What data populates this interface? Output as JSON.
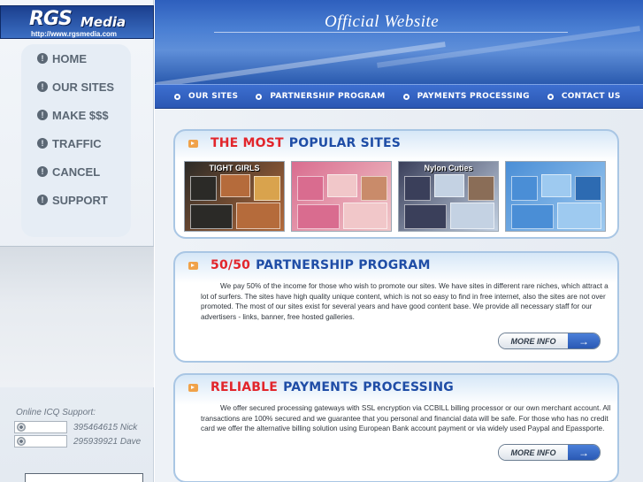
{
  "logo": {
    "brand": "RGS",
    "name": "Media",
    "url": "http://www.rgsmedia.com"
  },
  "header": {
    "title": "Official Website"
  },
  "sidebar": {
    "items": [
      {
        "label": "HOME",
        "icon": "info-bullet-icon"
      },
      {
        "label": "OUR SITES",
        "icon": "info-bullet-icon"
      },
      {
        "label": "MAKE $$$",
        "icon": "info-bullet-icon"
      },
      {
        "label": "TRAFFIC",
        "icon": "info-bullet-icon"
      },
      {
        "label": "CANCEL",
        "icon": "info-bullet-icon"
      },
      {
        "label": "SUPPORT",
        "icon": "info-bullet-icon"
      }
    ],
    "icq": {
      "title": "Online ICQ Support:",
      "contacts": [
        {
          "number": "395464615",
          "name": "Nick"
        },
        {
          "number": "295939921",
          "name": "Dave"
        }
      ]
    }
  },
  "topnav": {
    "items": [
      {
        "label": "OUR SITES"
      },
      {
        "label": "PARTNERSHIP PROGRAM"
      },
      {
        "label": "PAYMENTS PROCESSING"
      },
      {
        "label": "CONTACT US"
      }
    ]
  },
  "sections": {
    "popular": {
      "title_red": "THE MOST",
      "title_blue": "POPULAR SITES",
      "thumbnails": [
        {
          "caption": "TIGHT GIRLS",
          "colors": [
            "#2b2a27",
            "#b56b3b",
            "#d9a34d"
          ]
        },
        {
          "caption": "",
          "colors": [
            "#d96c8f",
            "#f1c7c9",
            "#c98b6a"
          ]
        },
        {
          "caption": "Nylon Cuties",
          "colors": [
            "#3a3f5a",
            "#c4d2e3",
            "#8a6d57"
          ]
        },
        {
          "caption": "",
          "colors": [
            "#4a8ed6",
            "#9ecaf0",
            "#2d6bb2"
          ]
        }
      ]
    },
    "partnership": {
      "title_red": "50/50",
      "title_blue": "PARTNERSHIP PROGRAM",
      "text": "We pay 50% of the income for those who wish to promote our sites. We have sites in different rare niches, which attract a lot of surfers. The sites have high quality unique content, which is not so easy to find in free internet, also the sites are not over promoted. The most of our sites exist for several years and have good content base. We provide all necessary staff for our advertisers - links, banner, free hosted galleries.",
      "button": "MORE INFO"
    },
    "payments": {
      "title_red": "RELIABLE",
      "title_blue": "PAYMENTS PROCESSING",
      "text": "We offer secured processing gateways with SSL encryption via CCBILL billing processor or our own merchant account. All transactions are 100% secured and we guarantee that you personal and financial data will be safe. For those who has no credit card we offer the alternative billing solution using European Bank account payment or via widely used Paypal and Epassporte.",
      "button": "MORE INFO"
    }
  },
  "colors": {
    "accent_red": "#e2252b",
    "accent_blue": "#1f4da6",
    "nav_blue": "#2b57b3",
    "bullet_orange": "#f0a24a"
  }
}
